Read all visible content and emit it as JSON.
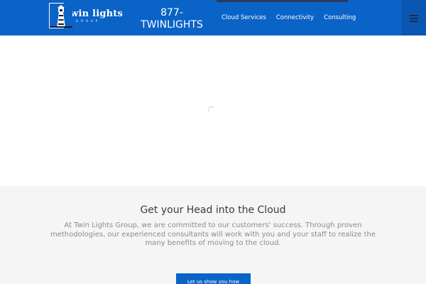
{
  "header": {
    "logo": {
      "name": "twin lights",
      "sub": "GROUP"
    },
    "phone": "877-TWINLIGHTS",
    "nav": [
      {
        "label": "Cloud Services",
        "active": true
      },
      {
        "label": "Connectivity",
        "active": false
      },
      {
        "label": "Consulting",
        "active": false
      }
    ],
    "menu_icon": "hamburger-icon"
  },
  "hero": {
    "loader_icon": "loading-spinner-icon"
  },
  "intro": {
    "title": "Get your Head into the Cloud",
    "body": "At Twin Lights Group, we are committed to our customers' success. Through proven methodologies, our experienced consultants will work with you and your staff to realize the many benefits of moving to the cloud.",
    "cta": "Let us show you how"
  },
  "colors": {
    "brand": "#0a63c7",
    "accent": "#2b3a5c",
    "section_bg": "#f5f5f5"
  }
}
